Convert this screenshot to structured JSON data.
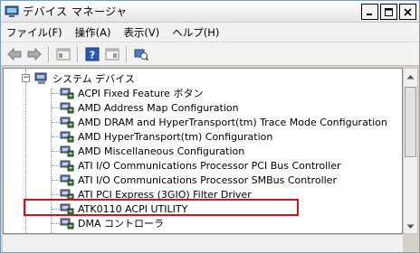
{
  "window": {
    "title": "デバイス マネージャ"
  },
  "menu": [
    {
      "label": "ファイル(F)"
    },
    {
      "label": "操作(A)"
    },
    {
      "label": "表示(V)"
    },
    {
      "label": "ヘルプ(H)"
    }
  ],
  "toolbar": {
    "buttons": [
      "back-arrow-icon",
      "forward-arrow-icon",
      "properties-view-icon",
      "help-icon",
      "console-tree-icon",
      "scan-hardware-icon"
    ]
  },
  "tree": {
    "category": "システム デバイス",
    "devices": [
      {
        "label": "ACPI Fixed Feature ボタン"
      },
      {
        "label": "AMD Address Map Configuration"
      },
      {
        "label": "AMD DRAM and HyperTransport(tm) Trace Mode Configuration"
      },
      {
        "label": "AMD HyperTransport(tm) Configuration"
      },
      {
        "label": "AMD Miscellaneous Configuration"
      },
      {
        "label": "ATI I/O Communications Processor PCI Bus Controller"
      },
      {
        "label": "ATI I/O Communications Processor SMBus Controller"
      },
      {
        "label": "ATI PCI Express (3GIO) Filter Driver"
      },
      {
        "label": "ATK0110 ACPI UTILITY",
        "highlighted": true
      },
      {
        "label": "DMA コントローラ"
      }
    ]
  },
  "colors": {
    "highlight": "#d1131b"
  }
}
